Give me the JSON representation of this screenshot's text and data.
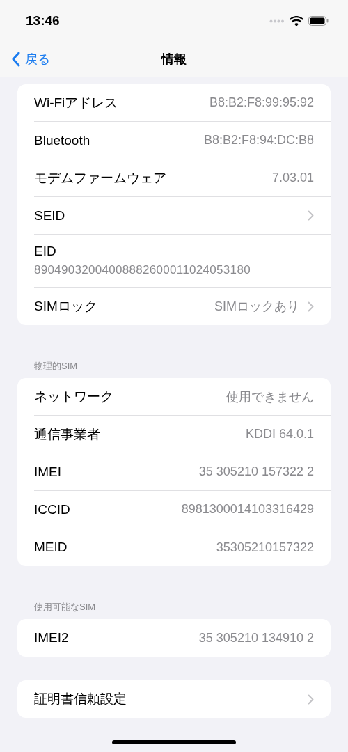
{
  "status_bar": {
    "time": "13:46"
  },
  "nav": {
    "back": "戻る",
    "title": "情報"
  },
  "groups": [
    {
      "rows": [
        {
          "kind": "value",
          "label": "Wi-Fiアドレス",
          "value": "B8:B2:F8:99:95:92"
        },
        {
          "kind": "value",
          "label": "Bluetooth",
          "value": "B8:B2:F8:94:DC:B8"
        },
        {
          "kind": "value",
          "label": "モデムファームウェア",
          "value": "7.03.01"
        },
        {
          "kind": "link",
          "label": "SEID"
        },
        {
          "kind": "stacked",
          "label": "EID",
          "value": "89049032004008882600011024053180"
        },
        {
          "kind": "link",
          "label": "SIMロック",
          "value": "SIMロックあり"
        }
      ]
    },
    {
      "header": "物理的SIM",
      "rows": [
        {
          "kind": "value",
          "label": "ネットワーク",
          "value": "使用できません"
        },
        {
          "kind": "value",
          "label": "通信事業者",
          "value": "KDDI 64.0.1"
        },
        {
          "kind": "value",
          "label": "IMEI",
          "value": "35 305210 157322 2"
        },
        {
          "kind": "value",
          "label": "ICCID",
          "value": "8981300014103316429"
        },
        {
          "kind": "value",
          "label": "MEID",
          "value": "35305210157322"
        }
      ]
    },
    {
      "header": "使用可能なSIM",
      "rows": [
        {
          "kind": "value",
          "label": "IMEI2",
          "value": "35 305210 134910 2"
        }
      ]
    },
    {
      "rows": [
        {
          "kind": "link",
          "label": "証明書信頼設定"
        }
      ]
    }
  ]
}
